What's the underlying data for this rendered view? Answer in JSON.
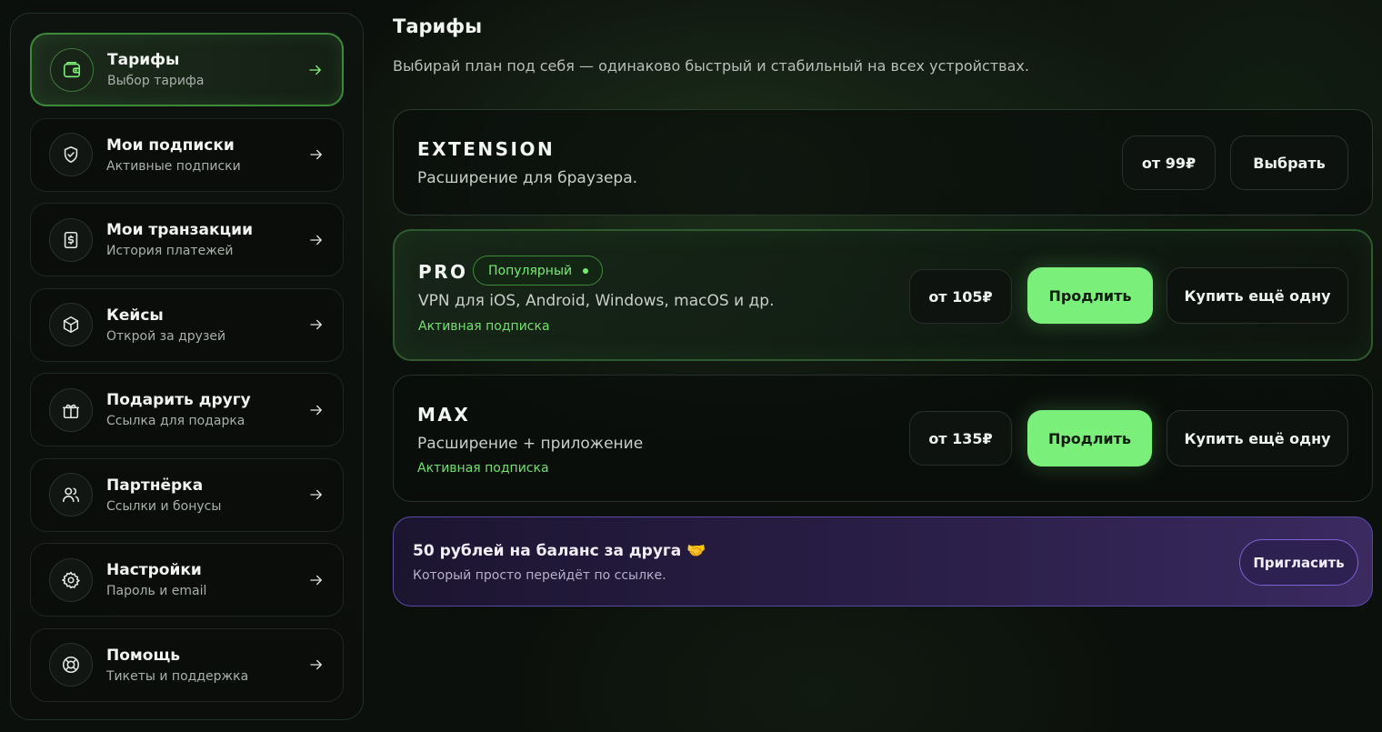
{
  "sidebar": {
    "items": [
      {
        "title": "Тарифы",
        "subtitle": "Выбор тарифа",
        "icon": "wallet-icon",
        "active": true
      },
      {
        "title": "Мои подписки",
        "subtitle": "Активные подписки",
        "icon": "shield-check-icon"
      },
      {
        "title": "Мои транзакции",
        "subtitle": "История платежей",
        "icon": "receipt-icon"
      },
      {
        "title": "Кейсы",
        "subtitle": "Открой за друзей",
        "icon": "box-icon"
      },
      {
        "title": "Подарить другу",
        "subtitle": "Ссылка для подарка",
        "icon": "gift-icon"
      },
      {
        "title": "Партнёрка",
        "subtitle": "Ссылки и бонусы",
        "icon": "users-icon"
      },
      {
        "title": "Настройки",
        "subtitle": "Пароль и email",
        "icon": "gear-icon"
      },
      {
        "title": "Помощь",
        "subtitle": "Тикеты и поддержка",
        "icon": "lifebuoy-icon"
      }
    ]
  },
  "main": {
    "title": "Тарифы",
    "description": "Выбирай план под себя — одинаково быстрый и стабильный на всех устройствах.",
    "plans": [
      {
        "name": "EXTENSION",
        "description": "Расширение для браузера.",
        "price": "от 99₽",
        "action": "Выбрать"
      },
      {
        "name": "PRO",
        "badge": "Популярный",
        "description": "VPN для iOS, Android, Windows, macOS и др.",
        "status": "Активная подписка",
        "price": "от 105₽",
        "primary_action": "Продлить",
        "secondary_action": "Купить ещё одну"
      },
      {
        "name": "MAX",
        "description": "Расширение + приложение",
        "status": "Активная подписка",
        "price": "от 135₽",
        "primary_action": "Продлить",
        "secondary_action": "Купить ещё одну"
      }
    ],
    "promo": {
      "title": "50 рублей на баланс за друга 🤝",
      "subtitle": "Который просто перейдёт по ссылке.",
      "action": "Пригласить"
    }
  },
  "colors": {
    "accent": "#7af07a",
    "promo": "#2a1f48",
    "background": "#0c100c"
  }
}
